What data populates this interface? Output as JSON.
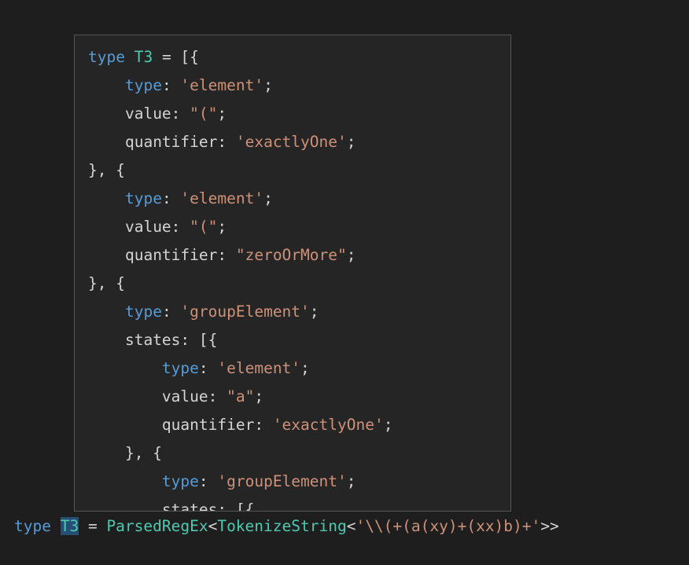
{
  "theme": {
    "editor_background": "#1e1e1e",
    "popup_background": "#252526",
    "popup_border": "#555555",
    "foreground": "#d4d4d4",
    "keyword_blue": "#569cd6",
    "type_teal": "#4ec9b0",
    "string_salmon": "#ce9178",
    "selection_highlight": "#264f78"
  },
  "hover_popup": {
    "name": "type-quick-info-popup",
    "lines": [
      {
        "indent": 0,
        "tokens": [
          {
            "text": "type",
            "kind": "keyword"
          },
          {
            "text": " ",
            "kind": "plain"
          },
          {
            "text": "T3",
            "kind": "type"
          },
          {
            "text": " = [{",
            "kind": "plain"
          }
        ]
      },
      {
        "indent": 1,
        "tokens": [
          {
            "text": "type",
            "kind": "property"
          },
          {
            "text": ": ",
            "kind": "plain"
          },
          {
            "text": "'element'",
            "kind": "string"
          },
          {
            "text": ";",
            "kind": "plain"
          }
        ]
      },
      {
        "indent": 1,
        "tokens": [
          {
            "text": "value",
            "kind": "plain"
          },
          {
            "text": ": ",
            "kind": "plain"
          },
          {
            "text": "\"(\"",
            "kind": "string"
          },
          {
            "text": ";",
            "kind": "plain"
          }
        ]
      },
      {
        "indent": 1,
        "tokens": [
          {
            "text": "quantifier",
            "kind": "plain"
          },
          {
            "text": ": ",
            "kind": "plain"
          },
          {
            "text": "'exactlyOne'",
            "kind": "string"
          },
          {
            "text": ";",
            "kind": "plain"
          }
        ]
      },
      {
        "indent": 0,
        "tokens": [
          {
            "text": "}, {",
            "kind": "plain"
          }
        ]
      },
      {
        "indent": 1,
        "tokens": [
          {
            "text": "type",
            "kind": "property"
          },
          {
            "text": ": ",
            "kind": "plain"
          },
          {
            "text": "'element'",
            "kind": "string"
          },
          {
            "text": ";",
            "kind": "plain"
          }
        ]
      },
      {
        "indent": 1,
        "tokens": [
          {
            "text": "value",
            "kind": "plain"
          },
          {
            "text": ": ",
            "kind": "plain"
          },
          {
            "text": "\"(\"",
            "kind": "string"
          },
          {
            "text": ";",
            "kind": "plain"
          }
        ]
      },
      {
        "indent": 1,
        "tokens": [
          {
            "text": "quantifier",
            "kind": "plain"
          },
          {
            "text": ": ",
            "kind": "plain"
          },
          {
            "text": "\"zeroOrMore\"",
            "kind": "string"
          },
          {
            "text": ";",
            "kind": "plain"
          }
        ]
      },
      {
        "indent": 0,
        "tokens": [
          {
            "text": "}, {",
            "kind": "plain"
          }
        ]
      },
      {
        "indent": 1,
        "tokens": [
          {
            "text": "type",
            "kind": "property"
          },
          {
            "text": ": ",
            "kind": "plain"
          },
          {
            "text": "'groupElement'",
            "kind": "string"
          },
          {
            "text": ";",
            "kind": "plain"
          }
        ]
      },
      {
        "indent": 1,
        "tokens": [
          {
            "text": "states",
            "kind": "plain"
          },
          {
            "text": ": [{",
            "kind": "plain"
          }
        ]
      },
      {
        "indent": 2,
        "tokens": [
          {
            "text": "type",
            "kind": "property"
          },
          {
            "text": ": ",
            "kind": "plain"
          },
          {
            "text": "'element'",
            "kind": "string"
          },
          {
            "text": ";",
            "kind": "plain"
          }
        ]
      },
      {
        "indent": 2,
        "tokens": [
          {
            "text": "value",
            "kind": "plain"
          },
          {
            "text": ": ",
            "kind": "plain"
          },
          {
            "text": "\"a\"",
            "kind": "string"
          },
          {
            "text": ";",
            "kind": "plain"
          }
        ]
      },
      {
        "indent": 2,
        "tokens": [
          {
            "text": "quantifier",
            "kind": "plain"
          },
          {
            "text": ": ",
            "kind": "plain"
          },
          {
            "text": "'exactlyOne'",
            "kind": "string"
          },
          {
            "text": ";",
            "kind": "plain"
          }
        ]
      },
      {
        "indent": 1,
        "tokens": [
          {
            "text": "}, {",
            "kind": "plain"
          }
        ]
      },
      {
        "indent": 2,
        "tokens": [
          {
            "text": "type",
            "kind": "property"
          },
          {
            "text": ": ",
            "kind": "plain"
          },
          {
            "text": "'groupElement'",
            "kind": "string"
          },
          {
            "text": ";",
            "kind": "plain"
          }
        ]
      },
      {
        "indent": 2,
        "tokens": [
          {
            "text": "states",
            "kind": "plain"
          },
          {
            "text": ": [{",
            "kind": "plain"
          }
        ]
      }
    ]
  },
  "source_line": {
    "name": "type-alias-declaration",
    "tokens": [
      {
        "text": "type",
        "kind": "keyword"
      },
      {
        "text": " ",
        "kind": "plain"
      },
      {
        "text": "T3",
        "kind": "type",
        "selected": true
      },
      {
        "text": " = ",
        "kind": "plain"
      },
      {
        "text": "ParsedRegEx",
        "kind": "type"
      },
      {
        "text": "<",
        "kind": "plain"
      },
      {
        "text": "TokenizeString",
        "kind": "type"
      },
      {
        "text": "<",
        "kind": "plain"
      },
      {
        "text": "'\\\\(+(a(xy)+(xx)b)+'",
        "kind": "string"
      },
      {
        "text": ">>",
        "kind": "plain"
      }
    ],
    "plain_text": "type T3 = ParsedRegEx<TokenizeString<'\\\\(+(a(xy)+(xx)b)+'>>"
  }
}
